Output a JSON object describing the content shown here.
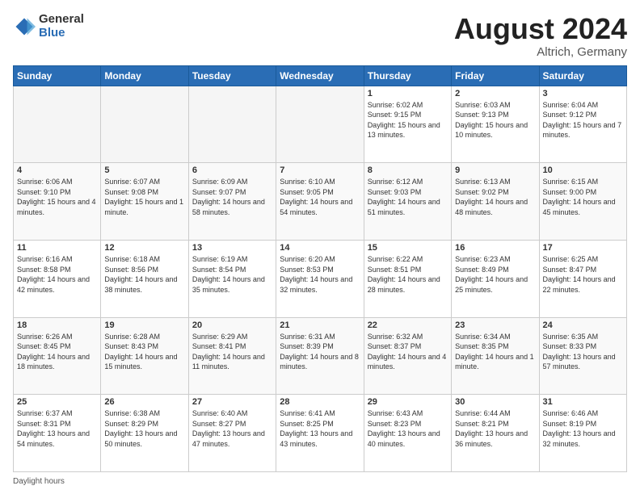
{
  "header": {
    "logo_general": "General",
    "logo_blue": "Blue",
    "title": "August 2024",
    "location": "Altrich, Germany"
  },
  "days_of_week": [
    "Sunday",
    "Monday",
    "Tuesday",
    "Wednesday",
    "Thursday",
    "Friday",
    "Saturday"
  ],
  "weeks": [
    [
      {
        "day": "",
        "info": ""
      },
      {
        "day": "",
        "info": ""
      },
      {
        "day": "",
        "info": ""
      },
      {
        "day": "",
        "info": ""
      },
      {
        "day": "1",
        "info": "Sunrise: 6:02 AM\nSunset: 9:15 PM\nDaylight: 15 hours and 13 minutes."
      },
      {
        "day": "2",
        "info": "Sunrise: 6:03 AM\nSunset: 9:13 PM\nDaylight: 15 hours and 10 minutes."
      },
      {
        "day": "3",
        "info": "Sunrise: 6:04 AM\nSunset: 9:12 PM\nDaylight: 15 hours and 7 minutes."
      }
    ],
    [
      {
        "day": "4",
        "info": "Sunrise: 6:06 AM\nSunset: 9:10 PM\nDaylight: 15 hours and 4 minutes."
      },
      {
        "day": "5",
        "info": "Sunrise: 6:07 AM\nSunset: 9:08 PM\nDaylight: 15 hours and 1 minute."
      },
      {
        "day": "6",
        "info": "Sunrise: 6:09 AM\nSunset: 9:07 PM\nDaylight: 14 hours and 58 minutes."
      },
      {
        "day": "7",
        "info": "Sunrise: 6:10 AM\nSunset: 9:05 PM\nDaylight: 14 hours and 54 minutes."
      },
      {
        "day": "8",
        "info": "Sunrise: 6:12 AM\nSunset: 9:03 PM\nDaylight: 14 hours and 51 minutes."
      },
      {
        "day": "9",
        "info": "Sunrise: 6:13 AM\nSunset: 9:02 PM\nDaylight: 14 hours and 48 minutes."
      },
      {
        "day": "10",
        "info": "Sunrise: 6:15 AM\nSunset: 9:00 PM\nDaylight: 14 hours and 45 minutes."
      }
    ],
    [
      {
        "day": "11",
        "info": "Sunrise: 6:16 AM\nSunset: 8:58 PM\nDaylight: 14 hours and 42 minutes."
      },
      {
        "day": "12",
        "info": "Sunrise: 6:18 AM\nSunset: 8:56 PM\nDaylight: 14 hours and 38 minutes."
      },
      {
        "day": "13",
        "info": "Sunrise: 6:19 AM\nSunset: 8:54 PM\nDaylight: 14 hours and 35 minutes."
      },
      {
        "day": "14",
        "info": "Sunrise: 6:20 AM\nSunset: 8:53 PM\nDaylight: 14 hours and 32 minutes."
      },
      {
        "day": "15",
        "info": "Sunrise: 6:22 AM\nSunset: 8:51 PM\nDaylight: 14 hours and 28 minutes."
      },
      {
        "day": "16",
        "info": "Sunrise: 6:23 AM\nSunset: 8:49 PM\nDaylight: 14 hours and 25 minutes."
      },
      {
        "day": "17",
        "info": "Sunrise: 6:25 AM\nSunset: 8:47 PM\nDaylight: 14 hours and 22 minutes."
      }
    ],
    [
      {
        "day": "18",
        "info": "Sunrise: 6:26 AM\nSunset: 8:45 PM\nDaylight: 14 hours and 18 minutes."
      },
      {
        "day": "19",
        "info": "Sunrise: 6:28 AM\nSunset: 8:43 PM\nDaylight: 14 hours and 15 minutes."
      },
      {
        "day": "20",
        "info": "Sunrise: 6:29 AM\nSunset: 8:41 PM\nDaylight: 14 hours and 11 minutes."
      },
      {
        "day": "21",
        "info": "Sunrise: 6:31 AM\nSunset: 8:39 PM\nDaylight: 14 hours and 8 minutes."
      },
      {
        "day": "22",
        "info": "Sunrise: 6:32 AM\nSunset: 8:37 PM\nDaylight: 14 hours and 4 minutes."
      },
      {
        "day": "23",
        "info": "Sunrise: 6:34 AM\nSunset: 8:35 PM\nDaylight: 14 hours and 1 minute."
      },
      {
        "day": "24",
        "info": "Sunrise: 6:35 AM\nSunset: 8:33 PM\nDaylight: 13 hours and 57 minutes."
      }
    ],
    [
      {
        "day": "25",
        "info": "Sunrise: 6:37 AM\nSunset: 8:31 PM\nDaylight: 13 hours and 54 minutes."
      },
      {
        "day": "26",
        "info": "Sunrise: 6:38 AM\nSunset: 8:29 PM\nDaylight: 13 hours and 50 minutes."
      },
      {
        "day": "27",
        "info": "Sunrise: 6:40 AM\nSunset: 8:27 PM\nDaylight: 13 hours and 47 minutes."
      },
      {
        "day": "28",
        "info": "Sunrise: 6:41 AM\nSunset: 8:25 PM\nDaylight: 13 hours and 43 minutes."
      },
      {
        "day": "29",
        "info": "Sunrise: 6:43 AM\nSunset: 8:23 PM\nDaylight: 13 hours and 40 minutes."
      },
      {
        "day": "30",
        "info": "Sunrise: 6:44 AM\nSunset: 8:21 PM\nDaylight: 13 hours and 36 minutes."
      },
      {
        "day": "31",
        "info": "Sunrise: 6:46 AM\nSunset: 8:19 PM\nDaylight: 13 hours and 32 minutes."
      }
    ]
  ],
  "footer": {
    "daylight_hours": "Daylight hours"
  }
}
